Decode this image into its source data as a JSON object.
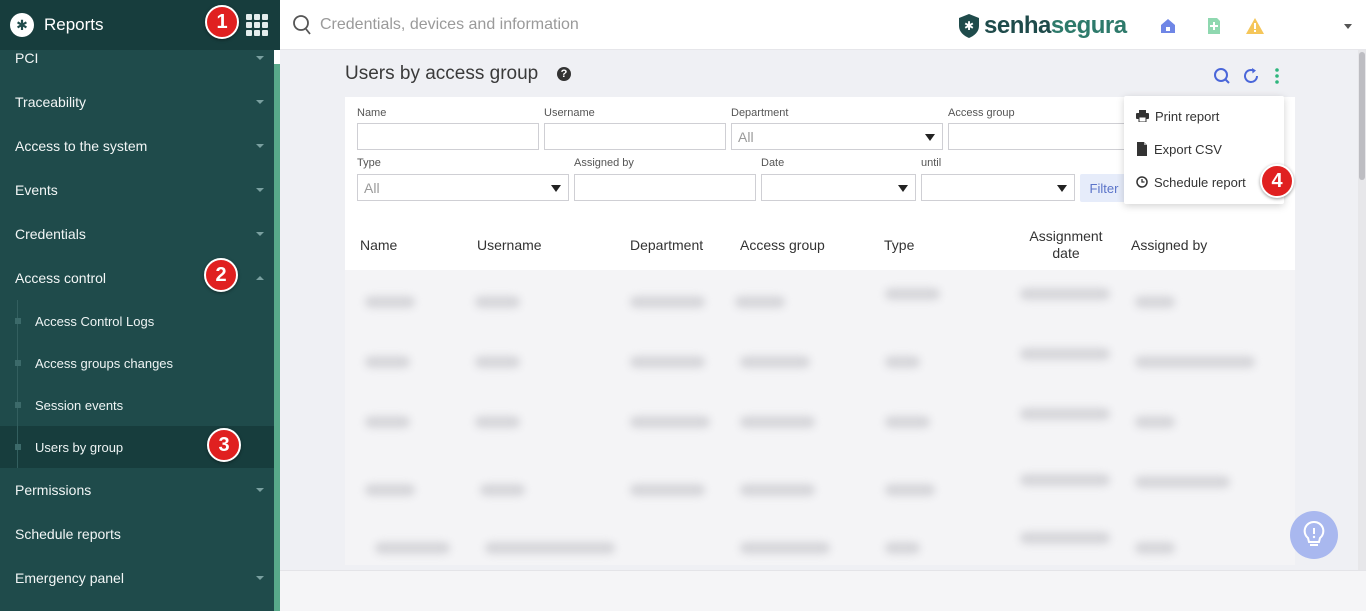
{
  "sidebar": {
    "title": "Reports",
    "items": [
      {
        "label": "PCI",
        "has_chevron": true
      },
      {
        "label": "Traceability",
        "has_chevron": true
      },
      {
        "label": "Access to the system",
        "has_chevron": true
      },
      {
        "label": "Events",
        "has_chevron": true
      },
      {
        "label": "Credentials",
        "has_chevron": true
      },
      {
        "label": "Access control",
        "has_chevron": true,
        "expanded": true
      }
    ],
    "subitems": [
      {
        "label": "Access Control Logs"
      },
      {
        "label": "Access groups changes"
      },
      {
        "label": "Session events"
      },
      {
        "label": "Users by group",
        "active": true
      }
    ],
    "items_after": [
      {
        "label": "Permissions",
        "has_chevron": true
      },
      {
        "label": "Schedule reports",
        "has_chevron": false
      },
      {
        "label": "Emergency panel",
        "has_chevron": true
      }
    ]
  },
  "topbar": {
    "search_placeholder": "Credentials, devices and information",
    "brand_part1": "senha",
    "brand_part2": "segura"
  },
  "page": {
    "title": "Users by access group",
    "help": "?"
  },
  "filters": {
    "name_label": "Name",
    "username_label": "Username",
    "department_label": "Department",
    "department_value": "All",
    "access_group_label": "Access group",
    "type_label": "Type",
    "type_value": "All",
    "assigned_by_label": "Assigned by",
    "date_label": "Date",
    "until_label": "until",
    "filter_button": "Filter"
  },
  "table": {
    "headers": [
      "Name",
      "Username",
      "Department",
      "Access group",
      "Type",
      "Assignment date",
      "Assigned by"
    ]
  },
  "menu": {
    "items": [
      {
        "label": "Print report",
        "icon": "printer-icon"
      },
      {
        "label": "Export CSV",
        "icon": "file-icon"
      },
      {
        "label": "Schedule report",
        "icon": "clock-icon"
      }
    ]
  },
  "annotations": [
    "1",
    "2",
    "3",
    "4"
  ],
  "colors": {
    "sidebar_bg": "#1f4b4b",
    "sidebar_header": "#173d3d",
    "accent_blue": "#4a66d9",
    "accent_green": "#2eb67d",
    "badge_red": "#e02020"
  }
}
